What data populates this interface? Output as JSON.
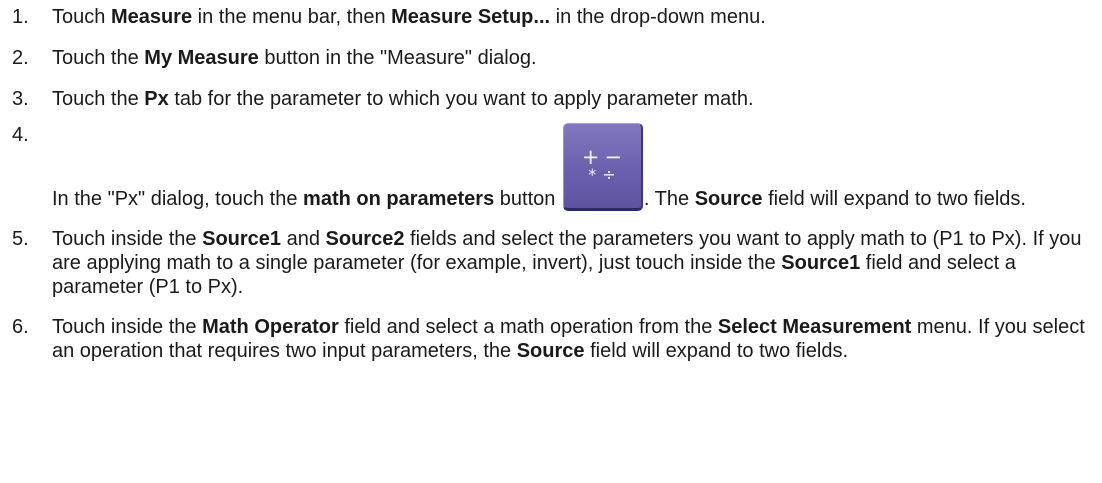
{
  "steps": [
    {
      "number": "1.",
      "t1": "Touch ",
      "b1": "Measure",
      "t2": " in the menu bar, then ",
      "b2": "Measure Setup...",
      "t3": " in the drop-down menu."
    },
    {
      "number": "2.",
      "t1": "Touch the ",
      "b1": "My Measure",
      "t2": " button in the \"Measure\" dialog."
    },
    {
      "number": "3.",
      "t1": "Touch the ",
      "b1": "Px",
      "t2": " tab for the parameter to which you want to apply parameter math."
    },
    {
      "number": "4.",
      "t1": "In the \"Px\" dialog, touch the ",
      "b1": "math on parameters",
      "t2": " button ",
      "icon": {
        "name": "math-on-parameters-icon",
        "row1": "+−",
        "row2": "*÷"
      },
      "t3": ". The ",
      "b2": "Source",
      "t4": " field will expand to two fields."
    },
    {
      "number": "5.",
      "t1": "Touch inside the ",
      "b1": "Source1",
      "t2": " and ",
      "b2": "Source2",
      "t3": " fields and select the parameters you want to apply math to (P1 to Px). If you are applying math to a single parameter (for example, invert), just touch inside the ",
      "b3": "Source1",
      "t4": " field and select a parameter (P1 to Px)."
    },
    {
      "number": "6.",
      "t1": "Touch inside the ",
      "b1": "Math Operator",
      "t2": " field and select a math operation from the ",
      "b2": "Select Measurement",
      "t3": " menu. If you select an operation that requires two input parameters, the ",
      "b3": "Source",
      "t4": " field will expand to two fields."
    }
  ],
  "colors": {
    "text": "#1a1a1a",
    "icon_face": "#6a60ad",
    "icon_glyph": "#f2f0fb"
  }
}
